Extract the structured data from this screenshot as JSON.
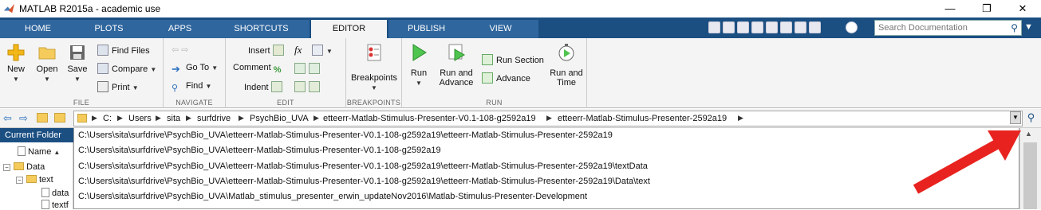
{
  "window": {
    "title": "MATLAB R2015a - academic use",
    "min": "—",
    "max": "❐",
    "close": "✕"
  },
  "tabs": [
    "HOME",
    "PLOTS",
    "APPS",
    "SHORTCUTS",
    "EDITOR",
    "PUBLISH",
    "VIEW"
  ],
  "active_tab": "EDITOR",
  "search": {
    "placeholder": "Search Documentation"
  },
  "ribbon": {
    "file": {
      "label": "FILE",
      "new": "New",
      "open": "Open",
      "save": "Save",
      "find_files": "Find Files",
      "compare": "Compare",
      "print": "Print"
    },
    "navigate": {
      "label": "NAVIGATE",
      "goto": "Go To",
      "find": "Find"
    },
    "edit": {
      "label": "EDIT",
      "insert": "Insert",
      "comment": "Comment",
      "indent": "Indent",
      "fx": "fx"
    },
    "breakpoints": {
      "label": "BREAKPOINTS",
      "breakpoints": "Breakpoints"
    },
    "run": {
      "label": "RUN",
      "run": "Run",
      "run_advance_1": "Run and",
      "run_advance_2": "Advance",
      "run_section": "Run Section",
      "advance": "Advance",
      "run_time_1": "Run and",
      "run_time_2": "Time"
    }
  },
  "address": {
    "crumbs": [
      "C:",
      "Users",
      "sita",
      "surfdrive",
      "PsychBio_UVA",
      "etteerr-Matlab-Stimulus-Presenter-V0.1-108-g2592a19",
      "etteerr-Matlab-Stimulus-Presenter-2592a19"
    ]
  },
  "current_folder": {
    "title": "Current Folder",
    "name_header": "Name",
    "sort": "▲",
    "tree": [
      {
        "label": "Data"
      },
      {
        "label": "text"
      },
      {
        "label": "data"
      },
      {
        "label": "textf"
      }
    ]
  },
  "history": [
    "C:\\Users\\sita\\surfdrive\\PsychBio_UVA\\etteerr-Matlab-Stimulus-Presenter-V0.1-108-g2592a19\\etteerr-Matlab-Stimulus-Presenter-2592a19",
    "C:\\Users\\sita\\surfdrive\\PsychBio_UVA\\etteerr-Matlab-Stimulus-Presenter-V0.1-108-g2592a19",
    "C:\\Users\\sita\\surfdrive\\PsychBio_UVA\\etteerr-Matlab-Stimulus-Presenter-V0.1-108-g2592a19\\etteerr-Matlab-Stimulus-Presenter-2592a19\\textData",
    "C:\\Users\\sita\\surfdrive\\PsychBio_UVA\\etteerr-Matlab-Stimulus-Presenter-V0.1-108-g2592a19\\etteerr-Matlab-Stimulus-Presenter-2592a19\\Data\\text",
    "C:\\Users\\sita\\surfdrive\\PsychBio_UVA\\Matlab_stimulus_presenter_erwin_updateNov2016\\Matlab-Stimulus-Presenter-Development"
  ],
  "colors": {
    "accent": "#1b4f82",
    "annotation": "#e8231f"
  }
}
